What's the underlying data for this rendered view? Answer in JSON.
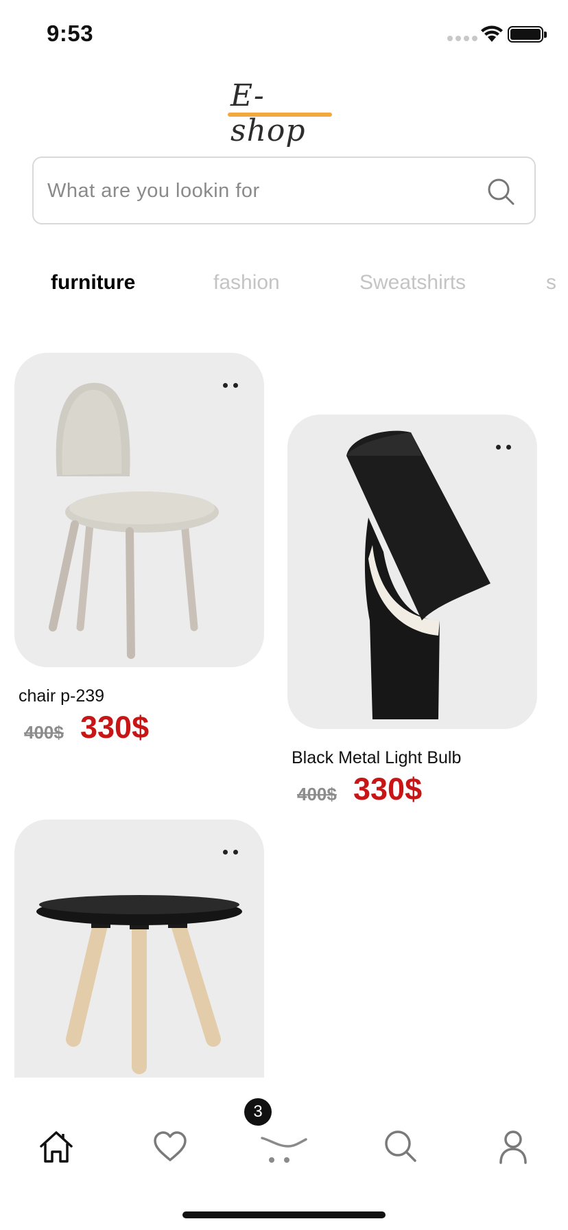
{
  "status_bar": {
    "time": "9:53"
  },
  "logo": {
    "text": "E-shop",
    "underline_color": "#f3a83b"
  },
  "search": {
    "placeholder": "What are you lookin for"
  },
  "tabs": [
    {
      "label": "furniture",
      "active": true
    },
    {
      "label": "fashion",
      "active": false
    },
    {
      "label": "Sweatshirts",
      "active": false
    },
    {
      "label": "s",
      "active": false
    }
  ],
  "products": [
    {
      "name": "chair p-239",
      "old_price": "400$",
      "price": "330$",
      "image": "chair"
    },
    {
      "name": "Black Metal Light Bulb",
      "old_price": "400$",
      "price": "330$",
      "image": "lamp"
    },
    {
      "name": "",
      "old_price": "",
      "price": "",
      "image": "side-table"
    }
  ],
  "bottom_nav": {
    "items": [
      "home-icon",
      "heart-icon",
      "cart-icon",
      "search-icon",
      "profile-icon"
    ],
    "cart_badge": "3"
  },
  "colors": {
    "price": "#c81515",
    "accent": "#f3a83b"
  }
}
